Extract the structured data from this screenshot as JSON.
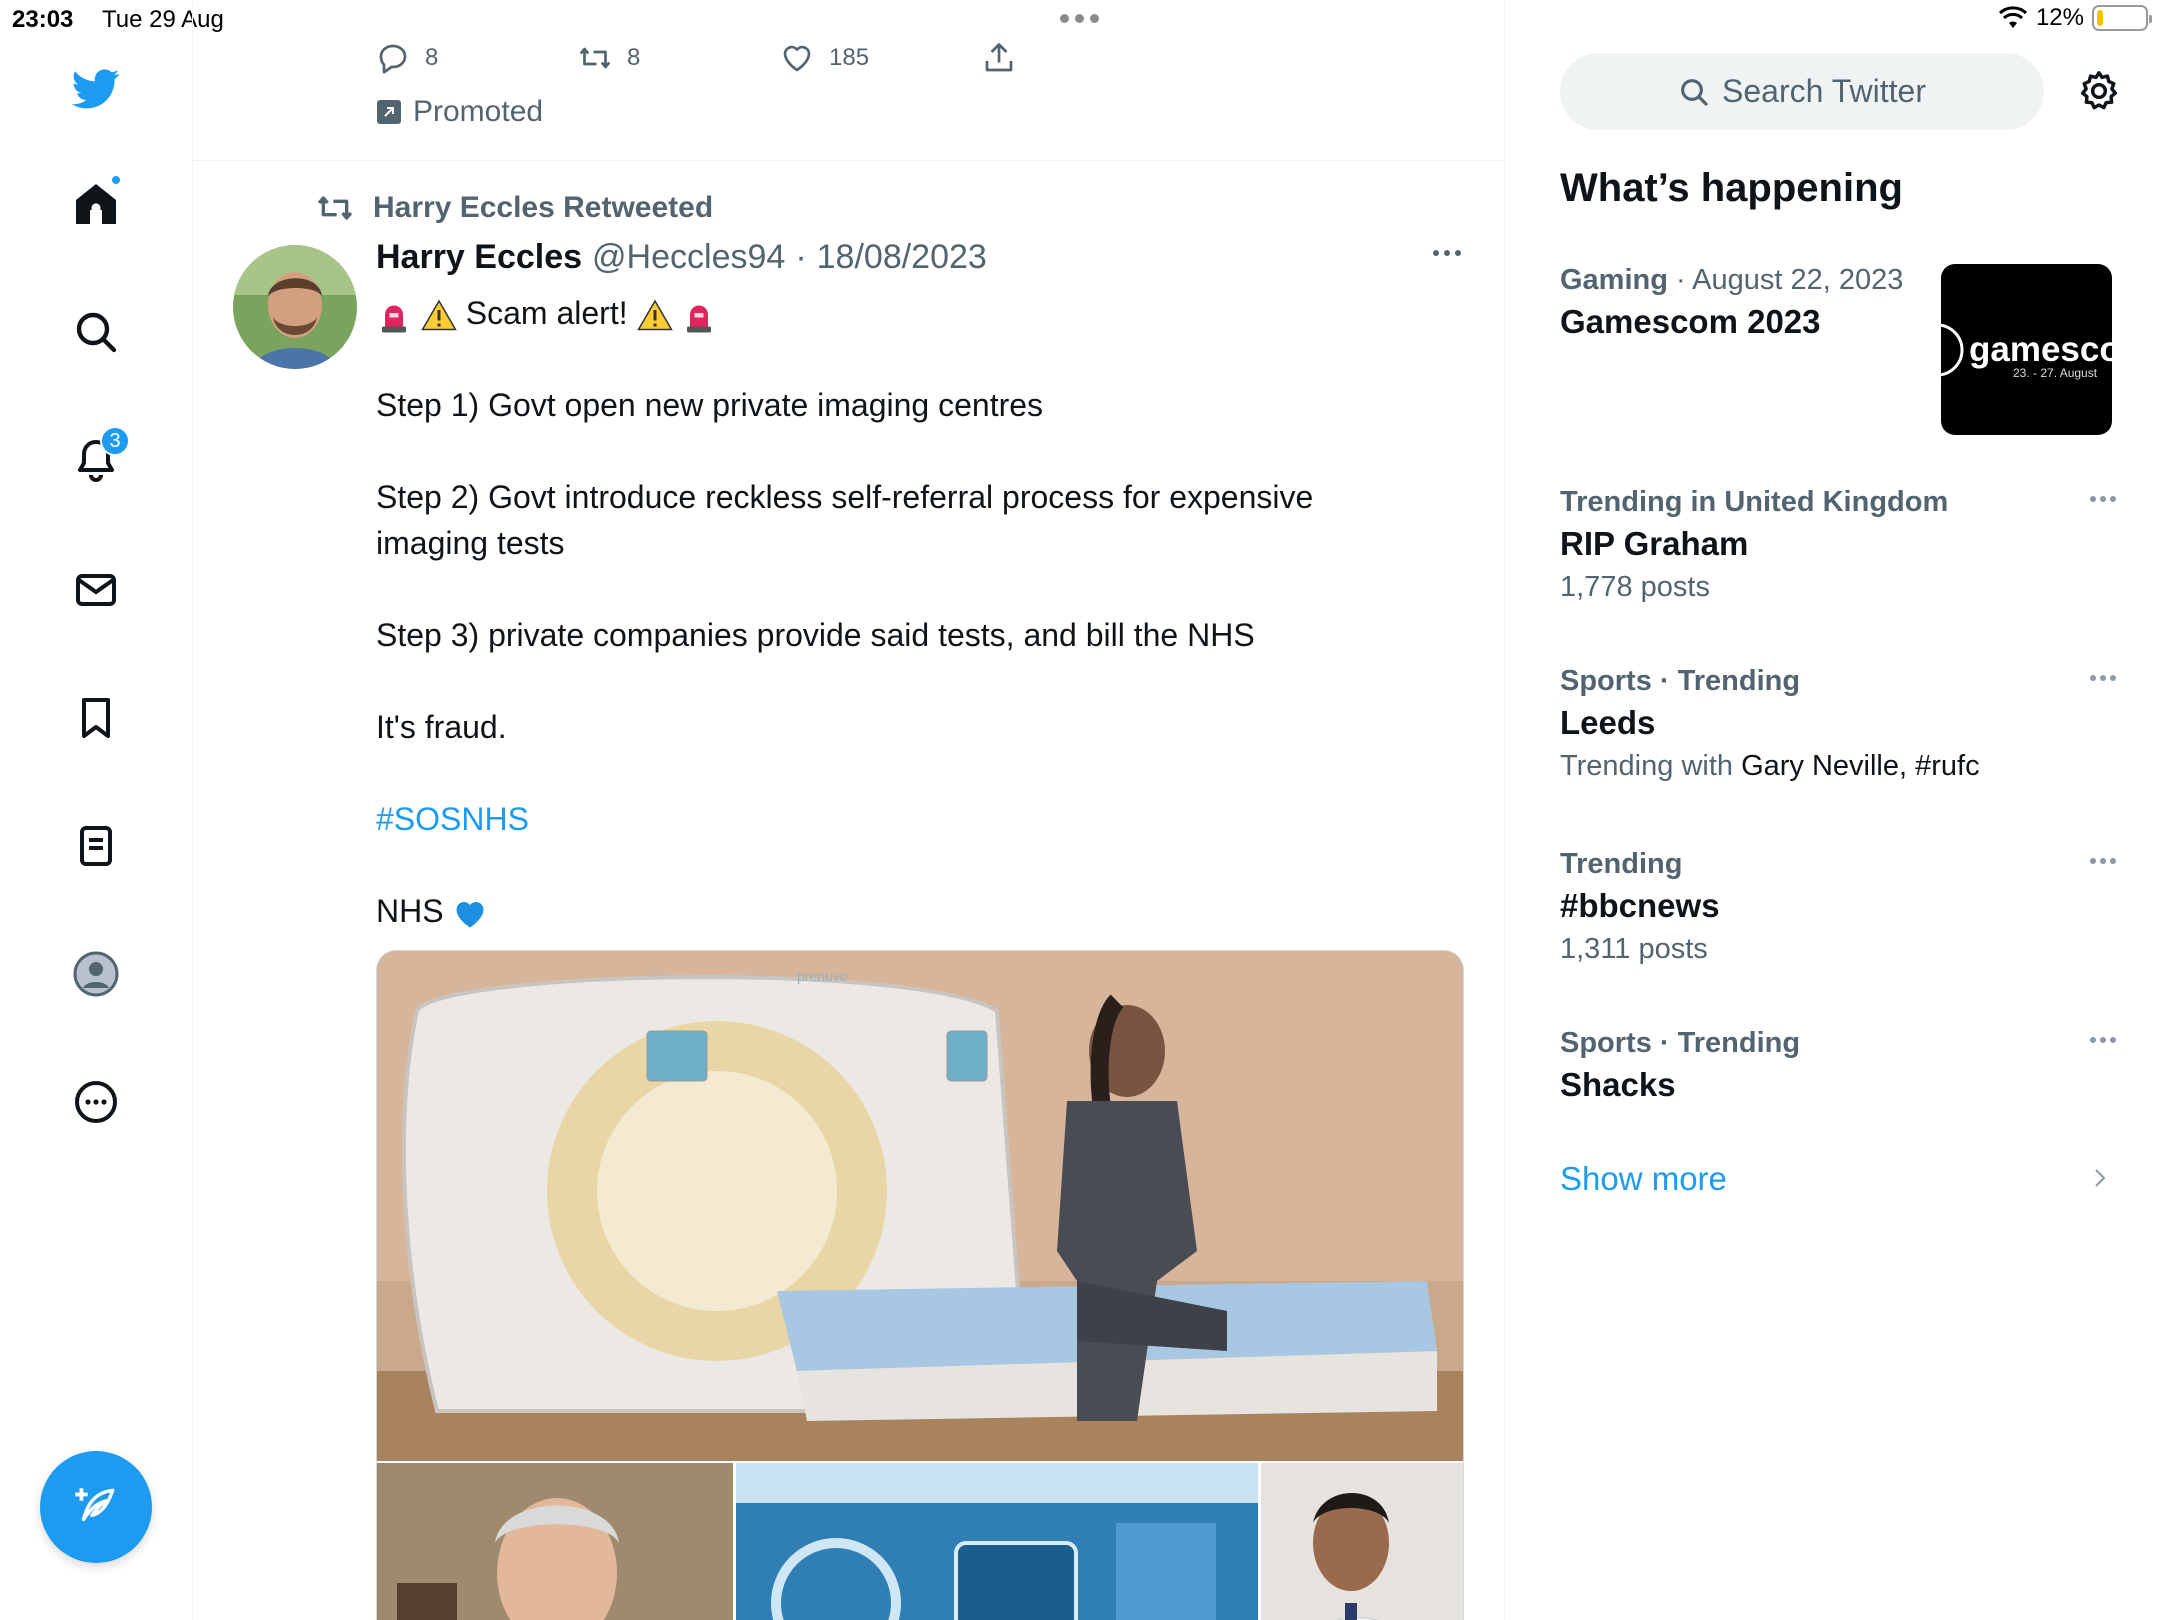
{
  "status_bar": {
    "time": "23:03",
    "date": "Tue 29 Aug",
    "battery": "12%"
  },
  "nav": {
    "notifications_badge": "3"
  },
  "promoted_tweet": {
    "reply_count": "8",
    "retweet_count": "8",
    "like_count": "185",
    "promoted_label": "Promoted"
  },
  "tweet": {
    "retweeted_by": "Harry Eccles Retweeted",
    "author_name": "Harry Eccles",
    "author_handle": "@Heccles94",
    "separator": "·",
    "date": "18/08/2023",
    "line1": "Scam alert!",
    "step1": "Step 1) Govt open new private imaging centres",
    "step2": "Step 2) Govt introduce reckless self-referral process for expensive imaging tests",
    "step3": "Step 3) private companies provide said tests, and bill the NHS",
    "fraud": "It's fraud.",
    "hashtag": "#SOSNHS",
    "nhs": "NHS",
    "media_watermark": "prenuvo"
  },
  "search": {
    "placeholder": "Search Twitter"
  },
  "whats_happening": {
    "title": "What’s happening",
    "trends": [
      {
        "category": "Gaming",
        "date": "August 22, 2023",
        "title": "Gamescom 2023",
        "thumb_text": "gamesco",
        "thumb_sub": "23. - 27. August"
      },
      {
        "meta": "Trending in United Kingdom",
        "title": "RIP Graham",
        "sub": "1,778 posts"
      },
      {
        "meta": "Sports · Trending",
        "title": "Leeds",
        "sub_prefix": "Trending with",
        "sub_names": "Gary Neville, #rufc"
      },
      {
        "meta": "Trending",
        "title": "#bbcnews",
        "sub": "1,311 posts"
      },
      {
        "meta": "Sports · Trending",
        "title": "Shacks"
      }
    ],
    "show_more": "Show more"
  },
  "colors": {
    "accent": "#1d9bf0",
    "text": "#0f1419",
    "muted": "#536471"
  }
}
